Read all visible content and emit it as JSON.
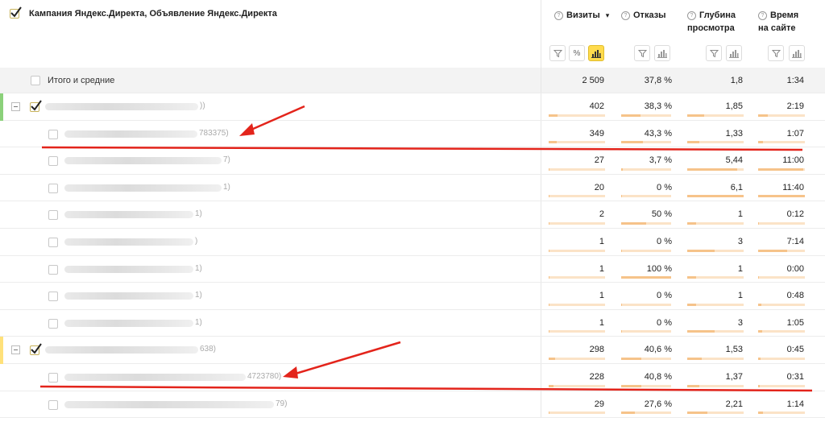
{
  "header": {
    "dimension_title": "Кампания Яндекс.Директа, Объявление Яндекс.Директа",
    "columns": [
      {
        "key": "visits",
        "label": "Визиты",
        "sort_indicator": "▾"
      },
      {
        "key": "bounces",
        "label": "Отказы",
        "sort_indicator": ""
      },
      {
        "key": "depth",
        "label": "Глубина просмотра",
        "sort_indicator": ""
      },
      {
        "key": "time",
        "label": "Время на сайте",
        "sort_indicator": ""
      }
    ],
    "column_buttons": [
      "filter-icon",
      "percent-icon",
      "bar-chart-icon"
    ]
  },
  "totals": {
    "label": "Итого и средние",
    "visits": "2 509",
    "bounces": "37,8 %",
    "depth": "1,8",
    "time": "1:34"
  },
  "rows": [
    {
      "level": 1,
      "checked": true,
      "marker_color": "#8bd17a",
      "tail": "))",
      "visits": "402",
      "bounces": "38,3 %",
      "depth": "1,85",
      "time": "2:19",
      "visits_pct": 0.16,
      "bounces_pct": 0.383,
      "depth_pct": 0.3,
      "time_pct": 0.2
    },
    {
      "level": 2,
      "checked": false,
      "marker_color": "",
      "tail": "783375)",
      "visits": "349",
      "bounces": "43,3 %",
      "depth": "1,33",
      "time": "1:07",
      "visits_pct": 0.139,
      "bounces_pct": 0.433,
      "depth_pct": 0.22,
      "time_pct": 0.1
    },
    {
      "level": 2,
      "checked": false,
      "marker_color": "",
      "tail": "7)",
      "visits": "27",
      "bounces": "3,7 %",
      "depth": "5,44",
      "time": "11:00",
      "visits_pct": 0.011,
      "bounces_pct": 0.037,
      "depth_pct": 0.89,
      "time_pct": 0.96
    },
    {
      "level": 2,
      "checked": false,
      "marker_color": "",
      "tail": "1)",
      "visits": "20",
      "bounces": "0 %",
      "depth": "6,1",
      "time": "11:40",
      "visits_pct": 0.008,
      "bounces_pct": 0.0,
      "depth_pct": 1.0,
      "time_pct": 1.0
    },
    {
      "level": 2,
      "checked": false,
      "marker_color": "",
      "tail": "1)",
      "visits": "2",
      "bounces": "50 %",
      "depth": "1",
      "time": "0:12",
      "visits_pct": 0.001,
      "bounces_pct": 0.5,
      "depth_pct": 0.16,
      "time_pct": 0.02
    },
    {
      "level": 2,
      "checked": false,
      "marker_color": "",
      "tail": ")",
      "visits": "1",
      "bounces": "0 %",
      "depth": "3",
      "time": "7:14",
      "visits_pct": 0.001,
      "bounces_pct": 0.0,
      "depth_pct": 0.49,
      "time_pct": 0.62
    },
    {
      "level": 2,
      "checked": false,
      "marker_color": "",
      "tail": "1)",
      "visits": "1",
      "bounces": "100 %",
      "depth": "1",
      "time": "0:00",
      "visits_pct": 0.001,
      "bounces_pct": 1.0,
      "depth_pct": 0.16,
      "time_pct": 0.0
    },
    {
      "level": 2,
      "checked": false,
      "marker_color": "",
      "tail": "1)",
      "visits": "1",
      "bounces": "0 %",
      "depth": "1",
      "time": "0:48",
      "visits_pct": 0.001,
      "bounces_pct": 0.0,
      "depth_pct": 0.16,
      "time_pct": 0.07
    },
    {
      "level": 2,
      "checked": false,
      "marker_color": "",
      "tail": "1)",
      "visits": "1",
      "bounces": "0 %",
      "depth": "3",
      "time": "1:05",
      "visits_pct": 0.001,
      "bounces_pct": 0.0,
      "depth_pct": 0.49,
      "time_pct": 0.09
    },
    {
      "level": 1,
      "checked": true,
      "marker_color": "#ffe17a",
      "tail": "638)",
      "visits": "298",
      "bounces": "40,6 %",
      "depth": "1,53",
      "time": "0:45",
      "visits_pct": 0.119,
      "bounces_pct": 0.406,
      "depth_pct": 0.25,
      "time_pct": 0.06
    },
    {
      "level": 2,
      "checked": false,
      "marker_color": "",
      "tail": "4723780)",
      "visits": "228",
      "bounces": "40,8 %",
      "depth": "1,37",
      "time": "0:31",
      "visits_pct": 0.091,
      "bounces_pct": 0.408,
      "depth_pct": 0.22,
      "time_pct": 0.04
    },
    {
      "level": 2,
      "checked": false,
      "marker_color": "",
      "tail": "79)",
      "visits": "29",
      "bounces": "27,6 %",
      "depth": "2,21",
      "time": "1:14",
      "visits_pct": 0.012,
      "bounces_pct": 0.276,
      "depth_pct": 0.36,
      "time_pct": 0.11
    }
  ],
  "annotations": {
    "color": "#e3241b",
    "items": [
      "arrow-1",
      "underline-1",
      "arrow-2",
      "underline-2"
    ]
  }
}
